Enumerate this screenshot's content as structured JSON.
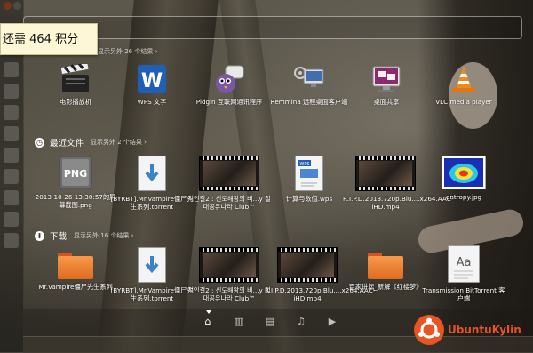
{
  "tooltip": {
    "text": "还需 464 积分"
  },
  "sections": {
    "apps": {
      "more": "显示另外 26 个结果",
      "items": [
        {
          "label": "电影播放机",
          "icon": "clapperboard-icon"
        },
        {
          "label": "WPS 文字",
          "icon": "wps-writer-icon"
        },
        {
          "label": "Pidgin 互联网通讯程序",
          "icon": "pidgin-icon"
        },
        {
          "label": "Remmina 远程桌面客户端",
          "icon": "remmina-icon"
        },
        {
          "label": "桌面共享",
          "icon": "desktop-sharing-icon"
        },
        {
          "label": "VLC media player",
          "icon": "vlc-cone-icon"
        }
      ]
    },
    "recent": {
      "title": "最近文件",
      "more": "显示另外 2 个结果",
      "items": [
        {
          "label": "2013-10-26 13:30:57的屏幕截图.png",
          "icon": "png-file-icon"
        },
        {
          "label": "[BYRBT].Mr.Vampire僵尸先生系列.torrent",
          "icon": "download-file-icon"
        },
        {
          "label": "적인걸2 : 신도해왕의 비...y 절대공유나라 Club™",
          "icon": "video-thumbnail-icon"
        },
        {
          "label": "计算与数值.wps",
          "icon": "wps-document-icon"
        },
        {
          "label": "R.I.P.D.2013.720p.Blu....x264.AAC-iHD.mp4",
          "icon": "video-thumbnail-icon"
        },
        {
          "label": "entropy.jpg",
          "icon": "image-thumbnail-icon"
        }
      ]
    },
    "downloads": {
      "title": "下载",
      "more": "显示另外 16 个结果",
      "items": [
        {
          "label": "Mr.Vampire僵尸先生系列",
          "icon": "folder-icon"
        },
        {
          "label": "[BYRBT].Mr.Vampire僵尸先生系列.torrent",
          "icon": "download-file-icon"
        },
        {
          "label": "적인걸2 : 신도해왕의 비...y 절대공유나라 Club™",
          "icon": "video-thumbnail-icon"
        },
        {
          "label": "R.I.P.D.2013.720p.Blu....x264.AAC-iHD.mp4",
          "icon": "video-thumbnail-icon"
        },
        {
          "label": "百家讲坛_新解《红楼梦》",
          "icon": "folder-icon"
        },
        {
          "label": "Transmission BitTorrent 客户端",
          "icon": "transmission-icon"
        }
      ]
    }
  },
  "lenses": [
    "home-lens-icon",
    "applications-lens-icon",
    "files-lens-icon",
    "music-lens-icon",
    "video-lens-icon"
  ],
  "brand": {
    "text": "UbuntuKylin"
  },
  "colors": {
    "accent": "#e95420",
    "tooltip_bg": "#fdf7d5"
  }
}
